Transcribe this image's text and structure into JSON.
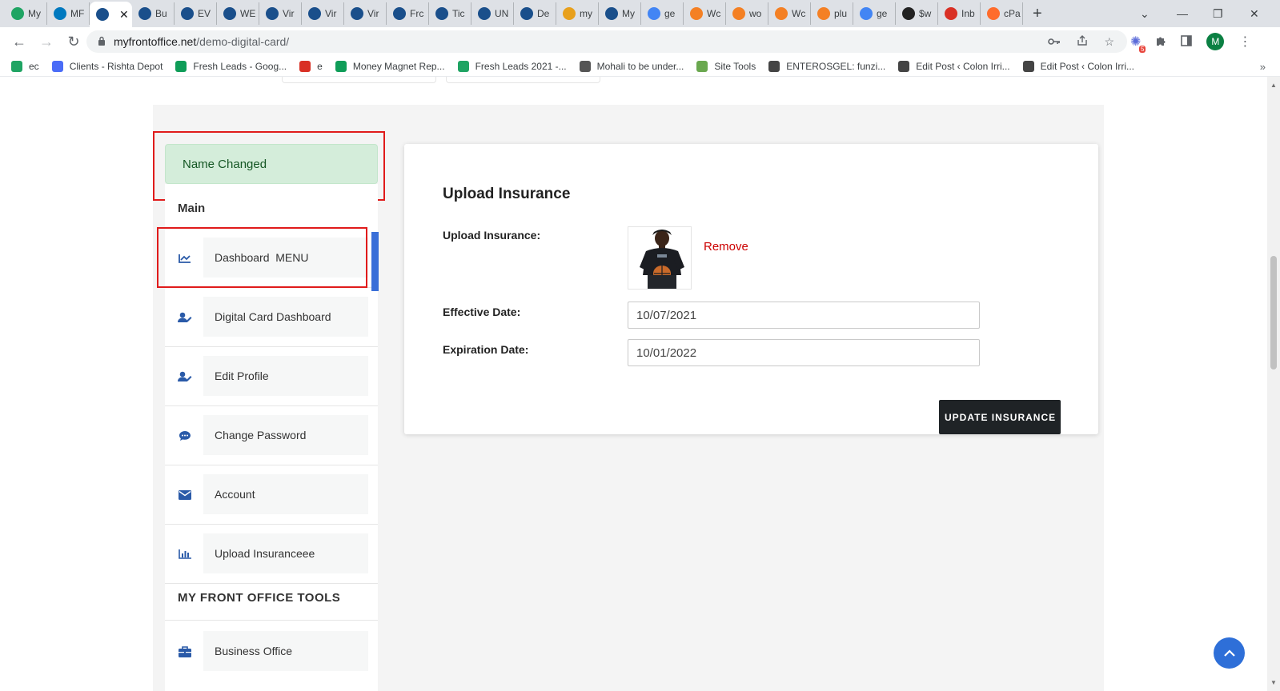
{
  "browser": {
    "tabs": [
      {
        "label": "My",
        "icon": "google-drive-icon",
        "color": "#1fa463"
      },
      {
        "label": "MF",
        "icon": "trello-icon",
        "color": "#0079bf"
      },
      {
        "label": "",
        "icon": "globe-icon",
        "color": "#1a4f8b",
        "active": true
      },
      {
        "label": "Bu",
        "icon": "globe-icon",
        "color": "#1a4f8b"
      },
      {
        "label": "EV",
        "icon": "globe-icon",
        "color": "#1a4f8b"
      },
      {
        "label": "WE",
        "icon": "globe-icon",
        "color": "#1a4f8b"
      },
      {
        "label": "Vir",
        "icon": "globe-icon",
        "color": "#1a4f8b"
      },
      {
        "label": "Vir",
        "icon": "globe-icon",
        "color": "#1a4f8b"
      },
      {
        "label": "Vir",
        "icon": "globe-icon",
        "color": "#1a4f8b"
      },
      {
        "label": "Frc",
        "icon": "globe-icon",
        "color": "#1a4f8b"
      },
      {
        "label": "Tic",
        "icon": "globe-icon",
        "color": "#1a4f8b"
      },
      {
        "label": "UN",
        "icon": "globe-icon",
        "color": "#1a4f8b"
      },
      {
        "label": "De",
        "icon": "globe-icon",
        "color": "#1a4f8b"
      },
      {
        "label": "my",
        "icon": "mountain-icon",
        "color": "#e8a01c"
      },
      {
        "label": "My",
        "icon": "globe-icon",
        "color": "#1a4f8b"
      },
      {
        "label": "ge",
        "icon": "google-icon",
        "color": "#4285f4"
      },
      {
        "label": "Wc",
        "icon": "stack-icon",
        "color": "#f48024"
      },
      {
        "label": "wo",
        "icon": "stack-icon",
        "color": "#f48024"
      },
      {
        "label": "Wc",
        "icon": "stack-icon",
        "color": "#f48024"
      },
      {
        "label": "plu",
        "icon": "stack-icon",
        "color": "#f48024"
      },
      {
        "label": "ge",
        "icon": "google-icon",
        "color": "#4285f4"
      },
      {
        "label": "$w",
        "icon": "wikipedia-icon",
        "color": "#222222"
      },
      {
        "label": "Inb",
        "icon": "gmail-icon",
        "color": "#d93025"
      },
      {
        "label": "cPa",
        "icon": "cpanel-icon",
        "color": "#ff6c2c"
      }
    ],
    "tab_close": "✕",
    "new_tab": "+",
    "window_controls": {
      "chevron": "⌄",
      "minimize": "—",
      "restore": "❐",
      "close": "✕"
    },
    "url_host": "myfrontoffice.net",
    "url_path": "/demo-digital-card/",
    "avatar_letter": "M",
    "ext_badge": "5",
    "bookmarks": [
      {
        "label": "ec",
        "color": "#1fa463"
      },
      {
        "label": "Clients - Rishta Depot",
        "color": "#4a6cf7"
      },
      {
        "label": "Fresh Leads - Goog...",
        "color": "#0f9d58"
      },
      {
        "label": "e",
        "color": "#d93025"
      },
      {
        "label": "Money Magnet Rep...",
        "color": "#0f9d58"
      },
      {
        "label": "Fresh Leads 2021 -...",
        "color": "#1fa463"
      },
      {
        "label": "Mohali to be under...",
        "color": "#555555"
      },
      {
        "label": "Site Tools",
        "color": "#6aa84f"
      },
      {
        "label": "ENTEROSGEL: funzi...",
        "color": "#444444"
      },
      {
        "label": "Edit Post ‹ Colon Irri...",
        "color": "#444444"
      },
      {
        "label": "Edit Post ‹ Colon Irri...",
        "color": "#444444"
      }
    ],
    "bookmarks_more": "»"
  },
  "alert": {
    "text": "Name Changed"
  },
  "sidebar": {
    "main_heading": "Main",
    "items": [
      {
        "label": "Dashboard  MENU",
        "icon": "chart-line-icon"
      },
      {
        "label": "Digital Card Dashboard",
        "icon": "user-edit-icon"
      },
      {
        "label": "Edit Profile",
        "icon": "user-edit-icon"
      },
      {
        "label": "Change Password",
        "icon": "comment-icon"
      },
      {
        "label": "Account",
        "icon": "envelope-icon"
      },
      {
        "label": "Upload Insuranceee",
        "icon": "chart-bar-icon"
      }
    ],
    "tools_heading": "MY FRONT OFFICE TOOLS",
    "tools_items": [
      {
        "label": "Business Office",
        "icon": "briefcase-icon"
      }
    ]
  },
  "card": {
    "title": "Upload Insurance",
    "upload_label": "Upload Insurance:",
    "remove_label": "Remove",
    "effective_label": "Effective Date:",
    "effective_value": "10/07/2021",
    "expiration_label": "Expiration Date:",
    "expiration_value": "10/01/2022",
    "update_button": "UPDATE INSURANCE"
  },
  "colors": {
    "accent": "#3a6fd8",
    "alert_bg": "#d4edda",
    "alert_text": "#155724",
    "highlight_box": "#e01b1b",
    "remove_link": "#cc0000",
    "button_bg": "#1f2326"
  }
}
